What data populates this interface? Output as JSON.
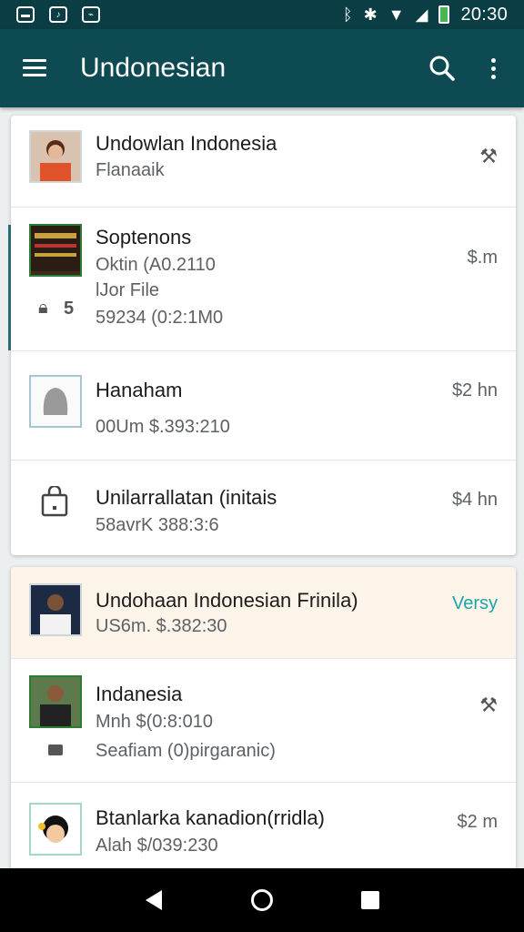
{
  "status_bar": {
    "time": "20:30",
    "left_icons": [
      "message-icon",
      "image-icon",
      "gallery-icon"
    ],
    "right_icons": [
      "bluetooth-icon",
      "vibrate-icon",
      "wifi-icon",
      "signal-icon",
      "battery-icon"
    ]
  },
  "app_bar": {
    "title": "Undonesian",
    "icons": [
      "menu-icon",
      "search-icon",
      "more-icon"
    ]
  },
  "list_groups": [
    {
      "items": [
        {
          "title": "Undowlan Indonesia",
          "subtitle": "Flanaaik",
          "meta": ""
        },
        {
          "title": "Soptenons",
          "subtitle": "Oktin (A0.2110",
          "line3": "lJor File",
          "line4": "59234 (0:2:1M0",
          "badge_count": "5",
          "meta": "$.m"
        },
        {
          "title": "Hanaham",
          "subtitle": "00Um $.393:210",
          "meta": "$2 hn"
        },
        {
          "title": "Unilarrallatan (initais",
          "subtitle": "58avrK 388:3:6",
          "meta": "$4 hn"
        }
      ]
    },
    {
      "items": [
        {
          "title": "Undohaan Indonesian Frinila)",
          "subtitle": "US6m. $.382:30",
          "meta": "Versy"
        },
        {
          "title": "Indanesia",
          "subtitle": "Mnh $(0:8:010",
          "line3": "Seafiam (0)pirgaranic)",
          "meta": ""
        },
        {
          "title": "Btanlarka kanadion(rridla)",
          "subtitle": "Alah $/039:230",
          "meta": "$2 m"
        }
      ]
    }
  ],
  "colors": {
    "app_bar": "#0e4a52",
    "status_bar": "#0b3d45",
    "accent": "#1ea3ad",
    "highlight_row": "#fdf4e9"
  }
}
